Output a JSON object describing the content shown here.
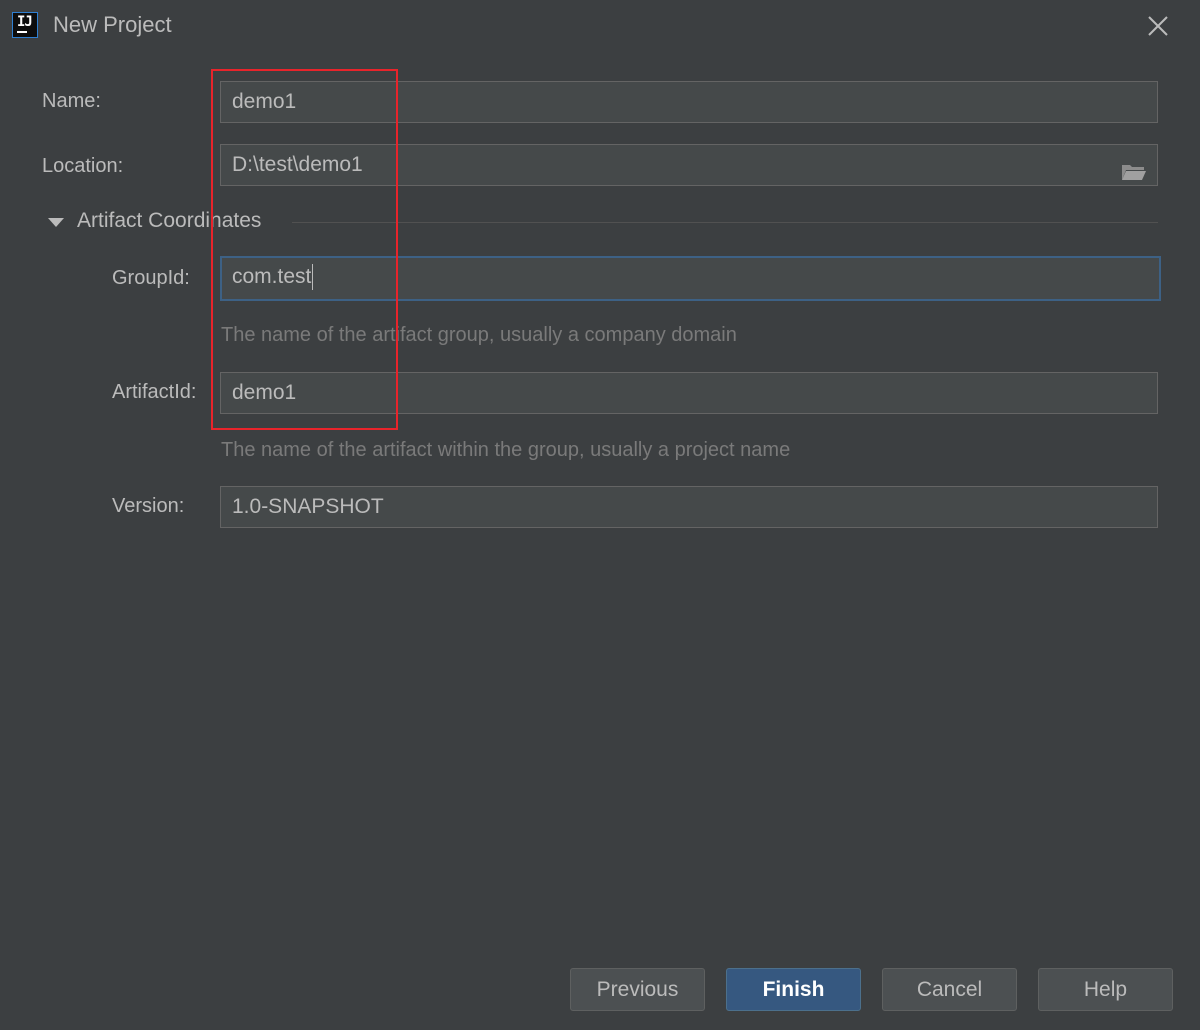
{
  "window": {
    "title": "New Project",
    "icon": "intellij-icon",
    "icon_text": "IJ"
  },
  "form": {
    "name": {
      "label": "Name:",
      "value": "demo1"
    },
    "location": {
      "label": "Location:",
      "value": "D:\\test\\demo1",
      "icon": "folder-icon"
    },
    "artifact_section": {
      "title": "Artifact Coordinates",
      "expanded": true
    },
    "group_id": {
      "label": "GroupId:",
      "value": "com.test",
      "hint": "The name of the artifact group, usually a company domain",
      "focused": true
    },
    "artifact_id": {
      "label": "ArtifactId:",
      "value": "demo1",
      "hint": "The name of the artifact within the group, usually a project name"
    },
    "version": {
      "label": "Version:",
      "value": "1.0-SNAPSHOT"
    }
  },
  "buttons": {
    "previous": "Previous",
    "finish": "Finish",
    "cancel": "Cancel",
    "help": "Help"
  },
  "colors": {
    "background": "#3c3f41",
    "field_background": "#45494a",
    "primary_button": "#365880",
    "focus_border": "#3d6185",
    "annotation_red": "#e8242b"
  }
}
